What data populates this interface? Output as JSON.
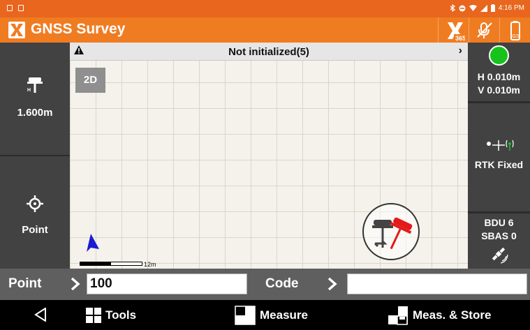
{
  "status_bar": {
    "time": "4:16 PM"
  },
  "app_bar": {
    "title": "GNSS Survey",
    "sub_badge": "365"
  },
  "left_panel": {
    "antenna_height": "1.600m",
    "point_label": "Point"
  },
  "map": {
    "banner_text": "Not initialized(5)",
    "view_mode": "2D",
    "scale_label": "12m"
  },
  "right_panel": {
    "fix_color": "#17c21d",
    "h_precision": "H 0.010m",
    "v_precision": "V 0.010m",
    "solution": "RTK Fixed",
    "bdu": "BDU 6",
    "sbas": "SBAS 0"
  },
  "input_bar": {
    "point_label": "Point",
    "point_value": "100",
    "code_label": "Code",
    "code_value": ""
  },
  "nav": {
    "tools": "Tools",
    "measure": "Measure",
    "meas_store": "Meas. & Store"
  },
  "colors": {
    "accent": "#f07c22",
    "panel": "#424242"
  }
}
